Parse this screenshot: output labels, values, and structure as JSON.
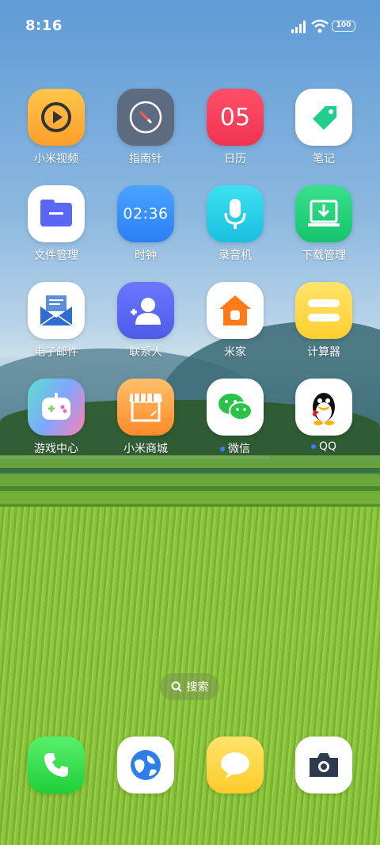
{
  "status": {
    "time": "8:16",
    "battery": "100"
  },
  "apps": [
    {
      "label": "小米视频"
    },
    {
      "label": "指南针"
    },
    {
      "label": "日历",
      "day": "05"
    },
    {
      "label": "笔记"
    },
    {
      "label": "文件管理"
    },
    {
      "label": "时钟",
      "time": "02:36"
    },
    {
      "label": "录音机"
    },
    {
      "label": "下载管理"
    },
    {
      "label": "电子邮件"
    },
    {
      "label": "联系人"
    },
    {
      "label": "米家"
    },
    {
      "label": "计算器"
    },
    {
      "label": "游戏中心"
    },
    {
      "label": "小米商城"
    },
    {
      "label": "微信"
    },
    {
      "label": "QQ"
    }
  ],
  "search": {
    "label": "搜索"
  },
  "dock": [
    "phone-icon",
    "browser-icon",
    "messages-icon",
    "camera-icon"
  ]
}
